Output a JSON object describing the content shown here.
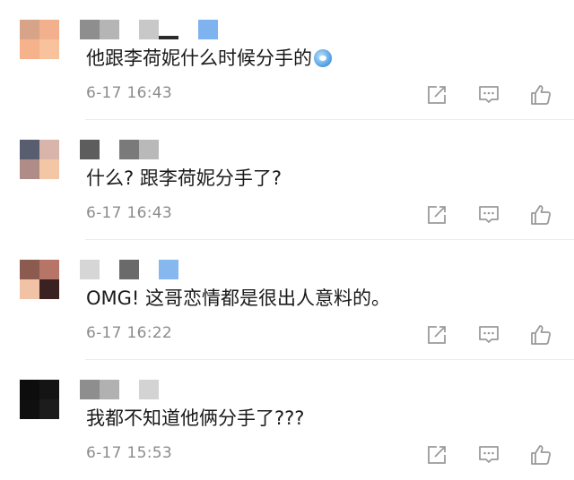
{
  "comments": [
    {
      "text": "他跟李荷妮什么时候分手的",
      "emoji": "doraemon-emoji",
      "time": "6-17 16:43",
      "avatar_colors": [
        "#d7a389",
        "#f2b08c",
        "#f6b28a",
        "#f8c29c"
      ],
      "name_blocks": [
        "#8e8e8e",
        "#b5b5b5",
        "#c8c8c8",
        "#2a2a2a",
        "#7fb3f0"
      ]
    },
    {
      "text": "什么? 跟李荷妮分手了?",
      "emoji": "",
      "time": "6-17 16:43",
      "avatar_colors": [
        "#595d70",
        "#d8b4ab",
        "#b08c88",
        "#f3c7a6"
      ],
      "name_blocks": [
        "#5d5d5d",
        "#7a7a7a",
        "#b9b9b9"
      ]
    },
    {
      "text": "OMG! 这哥恋情都是很出人意料的。",
      "emoji": "",
      "time": "6-17 16:22",
      "avatar_colors": [
        "#8c5b4f",
        "#b67566",
        "#f1c2a6",
        "#3a2222"
      ],
      "name_blocks": [
        "#d6d6d6",
        "#6a6a6a",
        "#86b7ef"
      ]
    },
    {
      "text": "我都不知道他俩分手了???",
      "emoji": "",
      "time": "6-17 15:53",
      "avatar_colors": [
        "#0d0d0d",
        "#141414",
        "#0f0f0f",
        "#1c1c1c"
      ],
      "name_blocks": [
        "#8e8e8e",
        "#b1b1b1",
        "#d3d3d3"
      ]
    }
  ],
  "icons": {
    "share": "share-icon",
    "reply": "comment-icon",
    "like": "thumbs-up-icon",
    "color": "#9a9a9a"
  }
}
